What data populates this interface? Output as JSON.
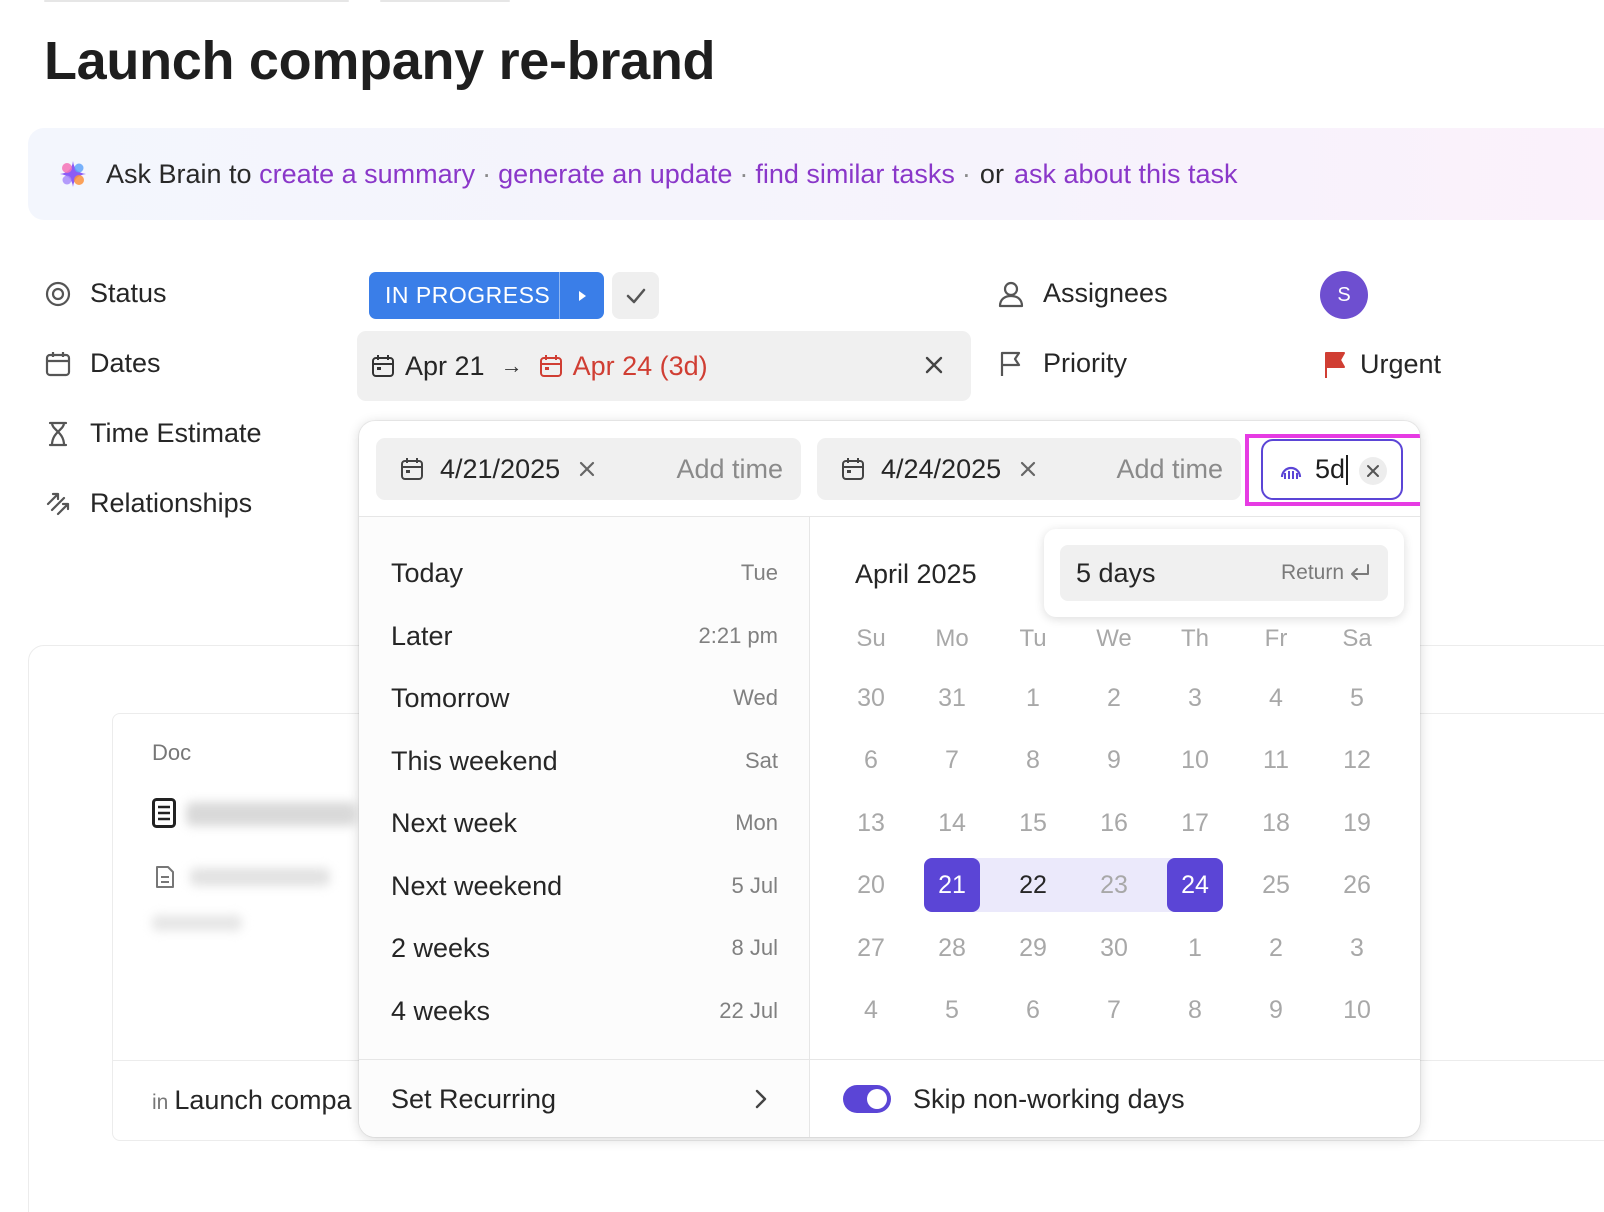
{
  "page": {
    "title": "Launch company re-brand"
  },
  "brain": {
    "prefix": "Ask Brain to",
    "link1": "create a summary",
    "link2": "generate an update",
    "link3": "find similar tasks",
    "or": "or",
    "link4": "ask about this task",
    "separator": "·"
  },
  "properties": {
    "status_label": "Status",
    "dates_label": "Dates",
    "time_estimate_label": "Time Estimate",
    "relationships_label": "Relationships",
    "assignees_label": "Assignees",
    "priority_label": "Priority"
  },
  "status": {
    "value": "IN PROGRESS",
    "color": "#3a7ee8"
  },
  "dates": {
    "start": "Apr 21",
    "arrow": "→",
    "due": "Apr 24 (3d)",
    "due_color": "#d03e33"
  },
  "assignee": {
    "initial": "S",
    "color": "#6e4fd0"
  },
  "priority": {
    "value": "Urgent",
    "flag_color": "#d03e33"
  },
  "popup": {
    "start_date": "4/21/2025",
    "due_date": "4/24/2025",
    "add_time": "Add time",
    "duration_value": "5d",
    "quick_options": [
      {
        "label": "Today",
        "value": "Tue"
      },
      {
        "label": "Later",
        "value": "2:21 pm"
      },
      {
        "label": "Tomorrow",
        "value": "Wed"
      },
      {
        "label": "This weekend",
        "value": "Sat"
      },
      {
        "label": "Next week",
        "value": "Mon"
      },
      {
        "label": "Next weekend",
        "value": "5 Jul"
      },
      {
        "label": "2 weeks",
        "value": "8 Jul"
      },
      {
        "label": "4 weeks",
        "value": "22 Jul"
      }
    ],
    "set_recurring": "Set Recurring",
    "skip_non_working": "Skip non-working days",
    "skip_non_working_enabled": true,
    "accent_color": "#5b45d6"
  },
  "calendar": {
    "month": "April 2025",
    "weekdays": [
      "Su",
      "Mo",
      "Tu",
      "We",
      "Th",
      "Fr",
      "Sa"
    ],
    "weeks": [
      [
        "30",
        "31",
        "1",
        "2",
        "3",
        "4",
        "5"
      ],
      [
        "6",
        "7",
        "8",
        "9",
        "10",
        "11",
        "12"
      ],
      [
        "13",
        "14",
        "15",
        "16",
        "17",
        "18",
        "19"
      ],
      [
        "20",
        "21",
        "22",
        "23",
        "24",
        "25",
        "26"
      ],
      [
        "27",
        "28",
        "29",
        "30",
        "1",
        "2",
        "3"
      ],
      [
        "4",
        "5",
        "6",
        "7",
        "8",
        "9",
        "10"
      ]
    ],
    "range_start": "21",
    "range_end": "24"
  },
  "suggestion": {
    "label": "5 days",
    "hint": "Return"
  },
  "background": {
    "doc_label": "Doc",
    "in_label": "in",
    "list_name": "Launch compa"
  }
}
